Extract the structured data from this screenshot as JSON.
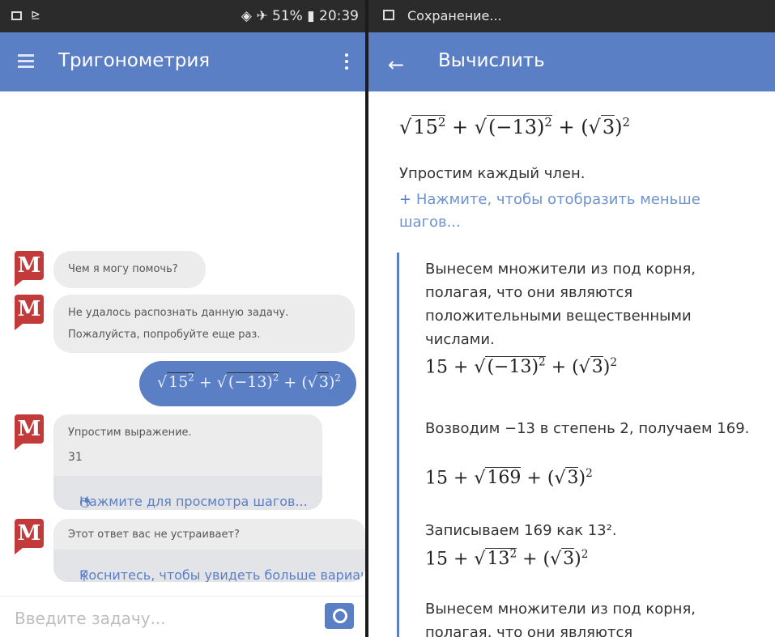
{
  "left": {
    "status": {
      "battery": "51%",
      "time": "20:39"
    },
    "title": "Тригонометрия",
    "messages": [
      {
        "type": "bot",
        "text": "Чем я могу помочь?"
      },
      {
        "type": "bot",
        "lines": [
          "Не удалось распознать данную задачу.",
          "Пожалуйста, попробуйте еще раз."
        ]
      },
      {
        "type": "user",
        "expression": "√15² + √(−13)² + (√3)²"
      },
      {
        "type": "bot",
        "lines": [
          "Упростим выражение.",
          "31"
        ],
        "action": "Нажмите для просмотра шагов..."
      },
      {
        "type": "bot",
        "text": "Этот ответ вас не устраивает?",
        "action": "Коснитесь, чтобы увидеть больше вариан"
      }
    ],
    "input": {
      "placeholder": "Введите задачу..."
    }
  },
  "right": {
    "status": {
      "text": "Сохранение..."
    },
    "title": "Вычислить",
    "expression": "√15² + √(−13)² + (√3)²",
    "simplify_text": "Упростим каждый член.",
    "expand_link": "Нажмите, чтобы отобразить меньше шагов...",
    "steps": [
      {
        "text": "Вынесем множители из под корня, полагая, что они являются положительными вещественными числами.",
        "math": "15 + √(−13)² + (√3)²"
      },
      {
        "text": "Возводим −13 в степень 2, получаем 169.",
        "math": "15 + √169 + (√3)²"
      },
      {
        "text": "Записываем 169 как 13².",
        "math": "15 + √13² + (√3)²"
      },
      {
        "text": "Вынесем множители из под корня, полагая, что они являются"
      }
    ]
  },
  "icons": [
    "sim-icon",
    "cast-icon",
    "wifi-icon",
    "airplane-icon",
    "battery-icon",
    "menu-icon",
    "overflow-menu-icon",
    "bot-avatar-icon",
    "steps-icon",
    "search-icon",
    "camera-icon",
    "save-icon",
    "back-arrow-icon",
    "plus-icon"
  ],
  "colors": {
    "accent": "#5b7fc4",
    "status_bar": "#2b2b2b",
    "avatar": "#c33a3a",
    "bubble": "#ececec",
    "link": "#6d93cf"
  }
}
